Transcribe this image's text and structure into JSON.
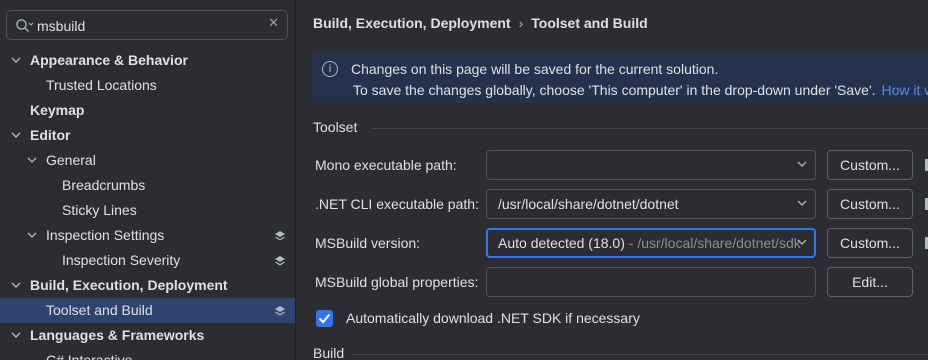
{
  "search": {
    "value": "msbuild",
    "placeholder": ""
  },
  "sidebar": {
    "items": [
      {
        "label": "Appearance & Behavior",
        "bold": true,
        "chevron": "down",
        "level": 0
      },
      {
        "label": "Trusted Locations",
        "bold": false,
        "chevron": "",
        "level": 1
      },
      {
        "label": "Keymap",
        "bold": true,
        "chevron": "",
        "level": 0
      },
      {
        "label": "Editor",
        "bold": true,
        "chevron": "down",
        "level": 0
      },
      {
        "label": "General",
        "bold": false,
        "chevron": "down",
        "level": 1
      },
      {
        "label": "Breadcrumbs",
        "bold": false,
        "chevron": "",
        "level": 2
      },
      {
        "label": "Sticky Lines",
        "bold": false,
        "chevron": "",
        "level": 2
      },
      {
        "label": "Inspection Settings",
        "bold": false,
        "chevron": "down",
        "level": 1,
        "icon": "layers-icon"
      },
      {
        "label": "Inspection Severity",
        "bold": false,
        "chevron": "",
        "level": 2,
        "icon": "layers-icon"
      },
      {
        "label": "Build, Execution, Deployment",
        "bold": true,
        "chevron": "down",
        "level": 0
      },
      {
        "label": "Toolset and Build",
        "bold": false,
        "chevron": "",
        "level": 1,
        "icon": "layers-icon",
        "selected": true
      },
      {
        "label": "Languages & Frameworks",
        "bold": true,
        "chevron": "down",
        "level": 0
      },
      {
        "label": "C# Interactive",
        "bold": false,
        "chevron": "",
        "level": 1
      }
    ]
  },
  "breadcrumb": {
    "parent": "Build, Execution, Deployment",
    "separator": "›",
    "current": "Toolset and Build"
  },
  "banner": {
    "line1": "Changes on this page will be saved for the current solution.",
    "line2": "To save the changes globally, choose 'This computer' in the drop-down under 'Save'.",
    "link": "How it w"
  },
  "toolset": {
    "title": "Toolset",
    "mono_label": "Mono executable path:",
    "mono_value": "",
    "dotnet_label": ".NET CLI executable path:",
    "dotnet_value": "/usr/local/share/dotnet/dotnet",
    "msbuild_label": "MSBuild version:",
    "msbuild_value": "Auto detected (18.0)",
    "msbuild_detail": " - /usr/local/share/dotnet/sdk",
    "props_label": "MSBuild global properties:",
    "props_value": "",
    "custom_label": "Custom...",
    "edit_label": "Edit...",
    "auto_download_label": "Automatically download .NET SDK if necessary",
    "auto_download_checked": true
  },
  "build": {
    "title": "Build"
  },
  "colors": {
    "accent": "#3574f0",
    "selection": "#2e436e",
    "banner_bg": "#25324d",
    "link": "#548af7"
  }
}
